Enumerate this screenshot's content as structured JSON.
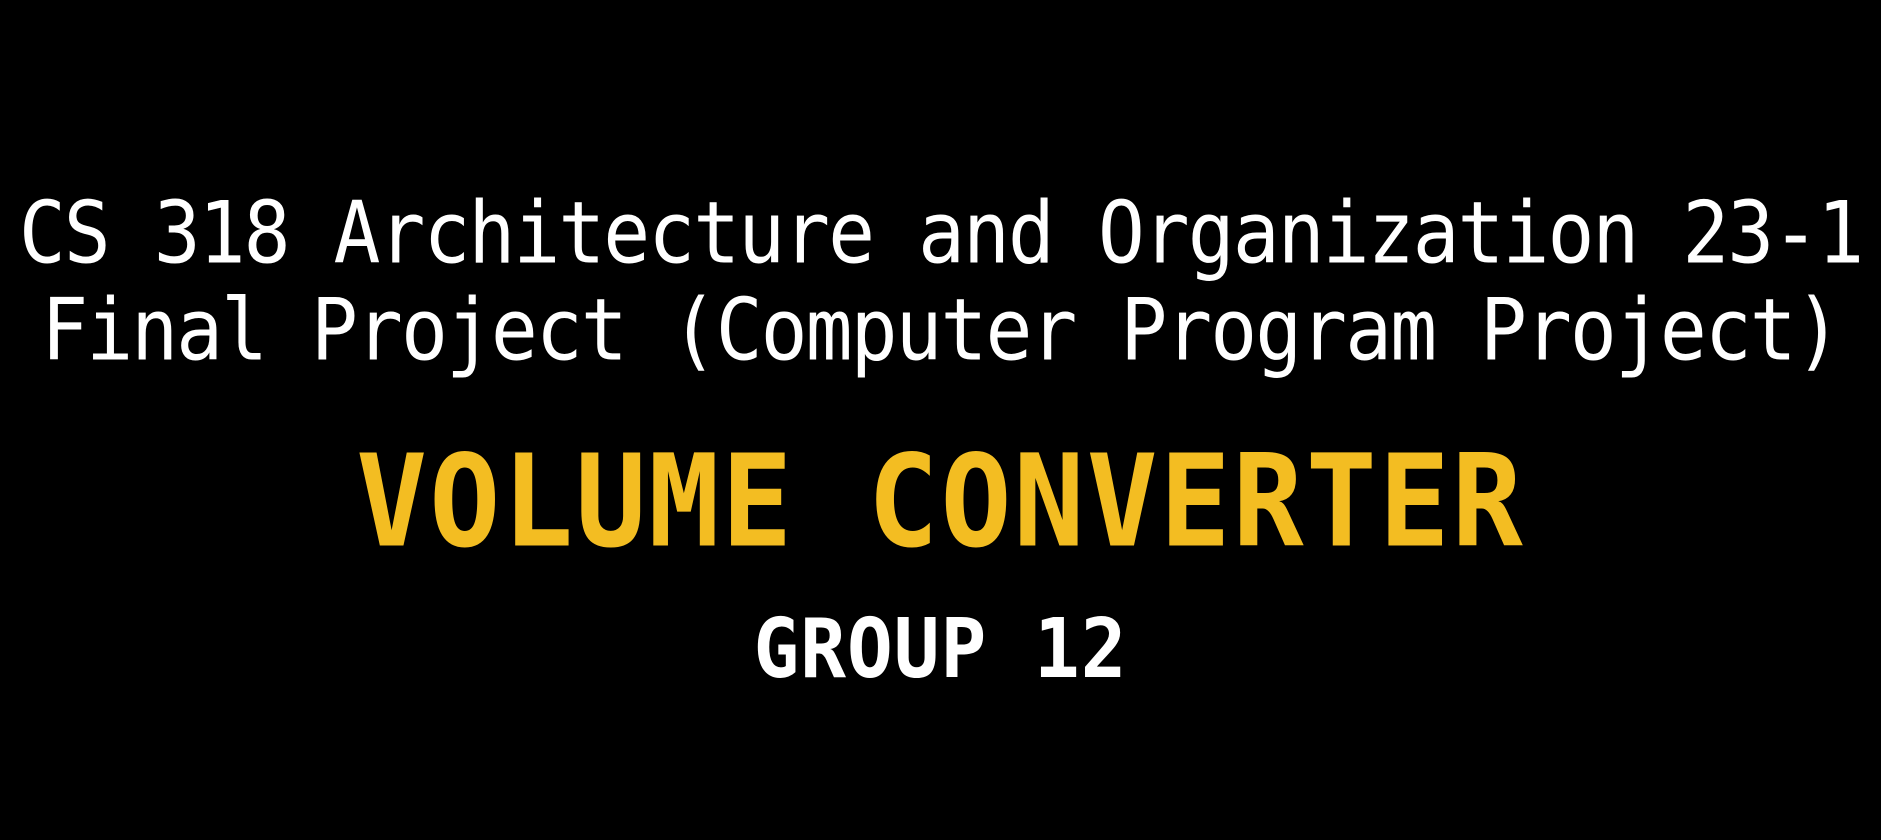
{
  "slide": {
    "course_line": "CS 318 Architecture and Organization 23-1",
    "project_line": "Final Project (Computer Program Project)",
    "title": "VOLUME CONVERTER",
    "group": "GROUP 12"
  },
  "colors": {
    "background": "#000000",
    "text_primary": "#ffffff",
    "accent": "#f3bd22"
  }
}
